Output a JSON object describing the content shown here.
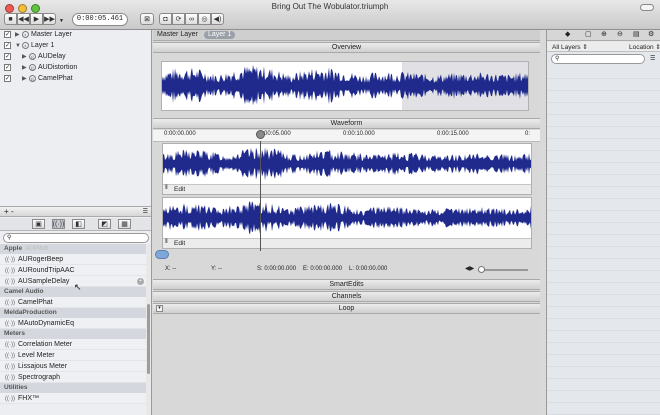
{
  "window": {
    "title": "Bring Out The Wobulator.triumph"
  },
  "transport": {
    "time": "0:00:05.461"
  },
  "layers": [
    {
      "label": "Master Layer",
      "indent": 0,
      "checked": true,
      "expanded": false
    },
    {
      "label": "Layer 1",
      "indent": 0,
      "checked": true,
      "expanded": true
    },
    {
      "label": "AUDelay",
      "indent": 1,
      "checked": true
    },
    {
      "label": "AUDistortion",
      "indent": 1,
      "checked": true
    },
    {
      "label": "CamelPhat",
      "indent": 1,
      "checked": true
    }
  ],
  "left_toolbar": {
    "add": "+",
    "remove": "-"
  },
  "plugins": {
    "search_placeholder": "",
    "ghost_item": "AUPitch",
    "categories": [
      {
        "name": "Apple",
        "items": [
          "AURogerBeep",
          "AURoundTripAAC",
          "AUSampleDelay"
        ]
      },
      {
        "name": "Camel Audio",
        "items": [
          "CamelPhat"
        ]
      },
      {
        "name": "MeldaProduction",
        "items": [
          "MAutoDynamicEq"
        ]
      },
      {
        "name": "Meters",
        "items": [
          "Correlation Meter",
          "Level Meter",
          "Lissajous Meter",
          "Spectrograph"
        ]
      },
      {
        "name": "Utilities",
        "items": [
          "FHX™"
        ]
      }
    ]
  },
  "center": {
    "breadcrumb": {
      "root": "Master Layer",
      "current": "Layer 1"
    },
    "overview_label": "Overview",
    "waveform_label": "Waveform",
    "ruler_ticks": [
      "0:00:00.000",
      "0:00:05.000",
      "0:00:10.000",
      "0:00:15.000",
      "0:"
    ],
    "edit_label": "Edit",
    "readout": {
      "x": "X: --",
      "y": "Y: --",
      "start": "S: 0:00:00.000",
      "end": "E: 0:00:00.000",
      "length": "L: 0:00:00.000"
    },
    "sections": [
      "SmartEdits",
      "Channels",
      "Loop"
    ]
  },
  "right": {
    "filter_label": "All Layers",
    "column_label": "Location",
    "search_placeholder": ""
  },
  "colors": {
    "waveform": "#1f2a8c",
    "accent": "#3b7fd8"
  }
}
